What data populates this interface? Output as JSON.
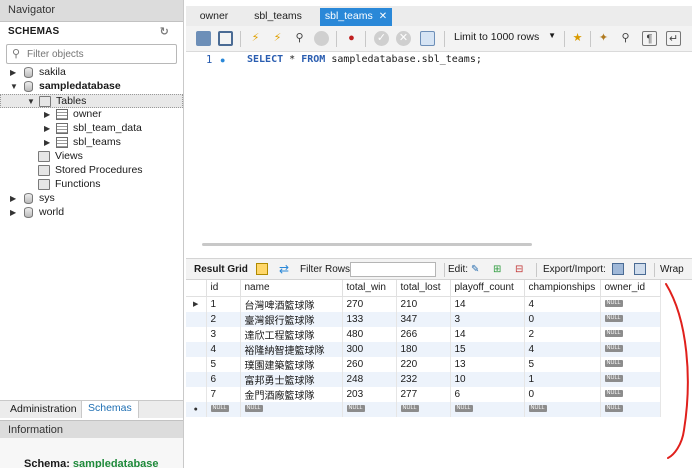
{
  "navigator": {
    "header": "Navigator",
    "schemas_title": "SCHEMAS",
    "filter_placeholder": "Filter objects",
    "tree": [
      {
        "label": "sakila"
      },
      {
        "label": "sampledatabase"
      },
      {
        "label": "Tables"
      },
      {
        "label": "owner"
      },
      {
        "label": "sbl_team_data"
      },
      {
        "label": "sbl_teams"
      },
      {
        "label": "Views"
      },
      {
        "label": "Stored Procedures"
      },
      {
        "label": "Functions"
      },
      {
        "label": "sys"
      },
      {
        "label": "world"
      }
    ],
    "bottom_tabs": [
      "Administration",
      "Schemas"
    ],
    "info_header": "Information",
    "info_schema_label": "Schema:",
    "info_schema_value": "sampledatabase"
  },
  "editor_tabs": [
    "owner",
    "sbl_teams",
    "sbl_teams"
  ],
  "toolbar": {
    "limit_label": "Limit to 1000 rows"
  },
  "editor": {
    "line_number": "1",
    "keyword_select": "SELECT",
    "star": "*",
    "keyword_from": "FROM",
    "target": "sampledatabase.sbl_teams;"
  },
  "result_bar": {
    "result_grid": "Result Grid",
    "filter_rows": "Filter Rows:",
    "edit": "Edit:",
    "export_import": "Export/Import:",
    "wrap": "Wrap"
  },
  "grid": {
    "columns": [
      "id",
      "name",
      "total_win",
      "total_lost",
      "playoff_count",
      "championships",
      "owner_id"
    ],
    "null_text": "NULL",
    "rows": [
      [
        "1",
        "台灣啤酒籃球隊",
        "270",
        "210",
        "14",
        "4"
      ],
      [
        "2",
        "臺灣銀行籃球隊",
        "133",
        "347",
        "3",
        "0"
      ],
      [
        "3",
        "達欣工程籃球隊",
        "480",
        "266",
        "14",
        "2"
      ],
      [
        "4",
        "裕隆納智捷籃球隊",
        "300",
        "180",
        "15",
        "4"
      ],
      [
        "5",
        "璞園建築籃球隊",
        "260",
        "220",
        "13",
        "5"
      ],
      [
        "6",
        "富邦勇士籃球隊",
        "248",
        "232",
        "10",
        "1"
      ],
      [
        "7",
        "金門酒廠籃球隊",
        "203",
        "277",
        "6",
        "0"
      ]
    ]
  }
}
